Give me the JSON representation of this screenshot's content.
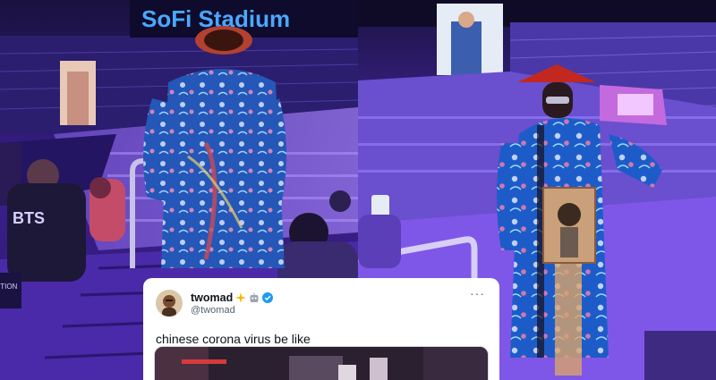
{
  "left_photo": {
    "stadium_sign": "SoFi Stadium",
    "shirt_text": "BTS",
    "corner_label": "ITION"
  },
  "tweet": {
    "display_name": "twomad",
    "handle": "@twomad",
    "more_label": "···",
    "text": "chinese corona virus be like"
  },
  "colors": {
    "stage_purple": "#5a2fd0",
    "stadium_sign": "#4aa8ff",
    "robe_blue": "#1f5fc4",
    "hat_red": "#c2281f",
    "verified_blue": "#1d9bf0"
  }
}
